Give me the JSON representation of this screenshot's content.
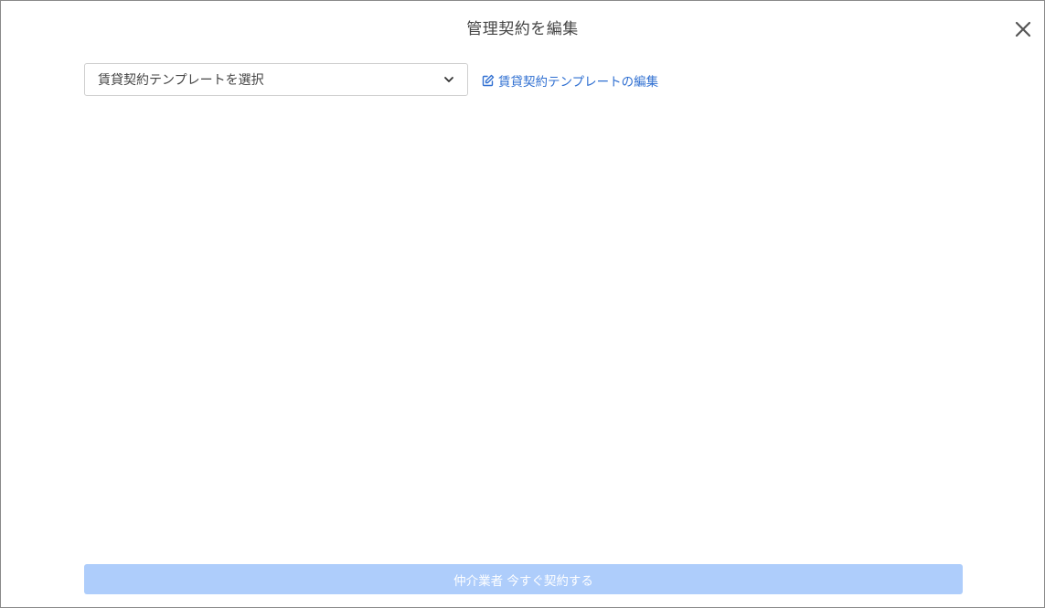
{
  "modal": {
    "title": "管理契約を編集",
    "close_icon": "close-icon"
  },
  "template": {
    "select_value": "賃貸契約テンプレートを選択",
    "edit_link_label": "賃貸契約テンプレートの編集",
    "edit_icon": "edit-icon"
  },
  "footer": {
    "submit_label": "仲介業者 今すぐ契約する"
  },
  "colors": {
    "link": "#2f6fd1",
    "submit_disabled_bg": "#aecdfb",
    "title_text": "#444444"
  }
}
